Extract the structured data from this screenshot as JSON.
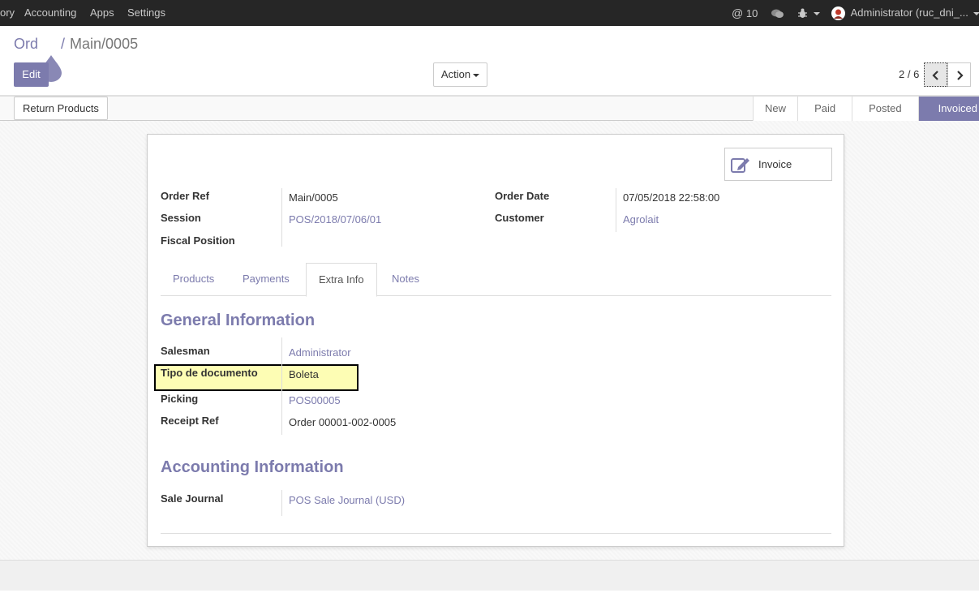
{
  "navbar": {
    "menus": [
      "ory",
      "Accounting",
      "Apps",
      "Settings"
    ],
    "mentions_count": "10",
    "user": "Administrator (ruc_dni_..."
  },
  "breadcrumb": {
    "parent": "Ord",
    "separator": "/",
    "current": "Main/0005"
  },
  "toolbar": {
    "edit_label": "Edit",
    "action_label": "Action",
    "pager": "2 / 6"
  },
  "statusbar": {
    "return_label": "Return Products",
    "stages": [
      "New",
      "Paid",
      "Posted",
      "Invoiced"
    ],
    "active_stage": "Invoiced"
  },
  "form": {
    "invoice_label": "Invoice",
    "order_ref_label": "Order Ref",
    "order_ref": "Main/0005",
    "session_label": "Session",
    "session": "POS/2018/07/06/01",
    "fiscal_position_label": "Fiscal Position",
    "order_date_label": "Order Date",
    "order_date": "07/05/2018 22:58:00",
    "customer_label": "Customer",
    "customer": "Agrolait"
  },
  "tabs": [
    "Products",
    "Payments",
    "Extra Info",
    "Notes"
  ],
  "active_tab": "Extra Info",
  "extra_info": {
    "general_title": "General Information",
    "salesman_label": "Salesman",
    "salesman": "Administrator",
    "tipo_label": "Tipo de documento",
    "tipo": "Boleta",
    "picking_label": "Picking",
    "picking": "POS00005",
    "receipt_label": "Receipt Ref",
    "receipt": "Order 00001-002-0005",
    "accounting_title": "Accounting Information",
    "journal_label": "Sale Journal",
    "journal": "POS Sale Journal (USD)"
  },
  "colors": {
    "brand": "#7c7bad",
    "navbar": "#262626",
    "highlight": "#fdfdb4"
  }
}
